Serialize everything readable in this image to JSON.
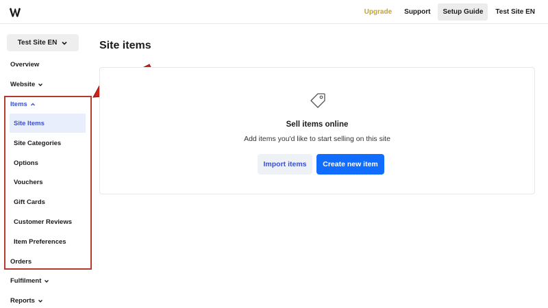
{
  "topbar": {
    "logo_icon": "weebly-w-icon",
    "upgrade": "Upgrade",
    "support": "Support",
    "setup_guide": "Setup Guide",
    "site_name": "Test Site EN"
  },
  "sidebar": {
    "site_switcher": "Test Site EN",
    "overview": "Overview",
    "website": "Website",
    "items": "Items",
    "sub_items": [
      {
        "label": "Site Items"
      },
      {
        "label": "Site Categories"
      },
      {
        "label": "Options"
      },
      {
        "label": "Vouchers"
      },
      {
        "label": "Gift Cards"
      },
      {
        "label": "Customer Reviews"
      },
      {
        "label": "Item Preferences"
      }
    ],
    "orders": "Orders",
    "fulfilment": "Fulfilment",
    "reports": "Reports"
  },
  "main": {
    "title": "Site items",
    "empty_state": {
      "icon": "price-tag-icon",
      "heading": "Sell items online",
      "description": "Add items you'd like to start selling on this site",
      "import_button": "Import items",
      "create_button": "Create new item"
    }
  },
  "colors": {
    "accent": "#116dff",
    "active_text": "#3b4fd1",
    "active_bg": "#e8eefc",
    "upgrade": "#c9a227",
    "annotation": "#b23a2b"
  }
}
